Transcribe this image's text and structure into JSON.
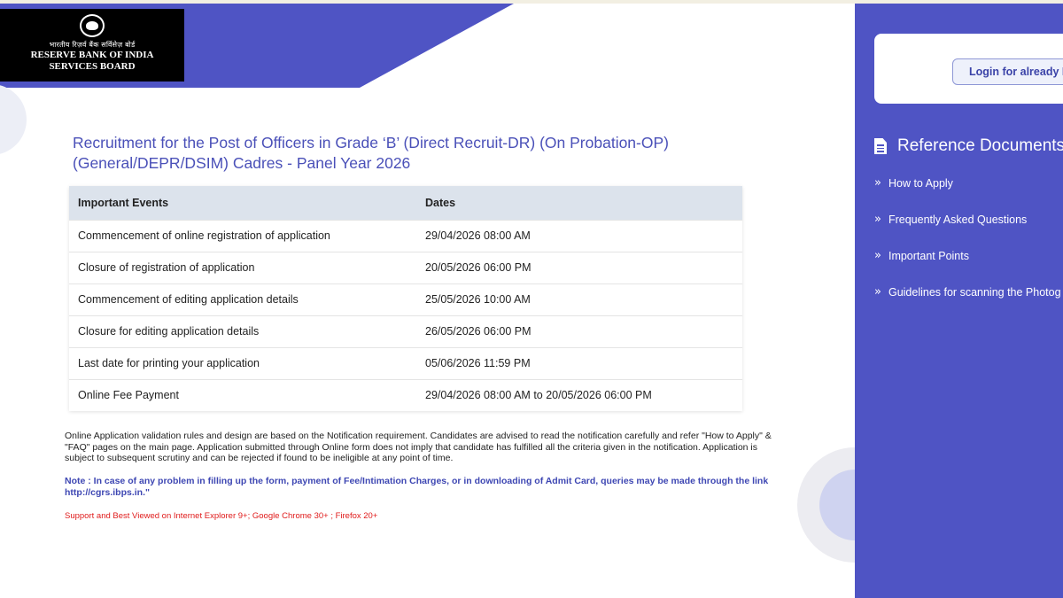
{
  "logo": {
    "hindi_name": "भारतीय रिज़र्व बैंक सर्विसेज़ बोर्ड",
    "english_line1": "RESERVE BANK OF INDIA",
    "english_line2": "SERVICES BOARD"
  },
  "main": {
    "title": "Recruitment for the Post of Officers in Grade ‘B’ (Direct Recruit-DR) (On Probation-OP) (General/DEPR/DSIM) Cadres - Panel Year 2026",
    "table": {
      "headers": [
        "Important Events",
        "Dates"
      ],
      "rows": [
        [
          "Commencement of online registration of application",
          "29/04/2026 08:00 AM"
        ],
        [
          "Closure of registration of application",
          "20/05/2026 06:00 PM"
        ],
        [
          "Commencement of editing application details",
          "25/05/2026 10:00 AM"
        ],
        [
          "Closure for editing application details",
          "26/05/2026 06:00 PM"
        ],
        [
          "Last date for printing your application",
          "05/06/2026 11:59 PM"
        ],
        [
          "Online Fee Payment",
          "29/04/2026 08:00 AM to 20/05/2026 06:00 PM"
        ]
      ]
    },
    "note_main": "Online Application validation rules and design are based on the Notification requirement. Candidates are advised to read the notification carefully and refer \"How to Apply\" & \"FAQ\" pages on the main page. Application submitted through Online form does not imply that candidate has fulfilled all the criteria given in the notification. Application is subject to subsequent scrutiny and can be rejected if found to be ineligible at any point of time.",
    "note_blue": "Note : In case of any problem in filling up the form, payment of Fee/Intimation Charges, or in downloading of Admit Card, queries may be made through the link http://cgrs.ibps.in.\"",
    "note_red": "Support and Best Viewed on Internet Explorer 9+; Google Chrome 30+ ; Firefox 20+"
  },
  "sidebar": {
    "login_label": "Login for already R",
    "ref_heading": "Reference Documents",
    "items": [
      {
        "label": "How to Apply"
      },
      {
        "label": "Frequently Asked Questions"
      },
      {
        "label": "Important Points"
      },
      {
        "label": "Guidelines for scanning the Photog"
      }
    ]
  },
  "colors": {
    "brand": "#4f54c4",
    "title": "#4a50b8",
    "header_row": "#dce3ec",
    "note_blue": "#3e47b3",
    "note_red": "#e01b1b"
  },
  "icons": [
    "document-icon",
    "chevron-double-right-icon",
    "rbi-emblem-icon"
  ]
}
